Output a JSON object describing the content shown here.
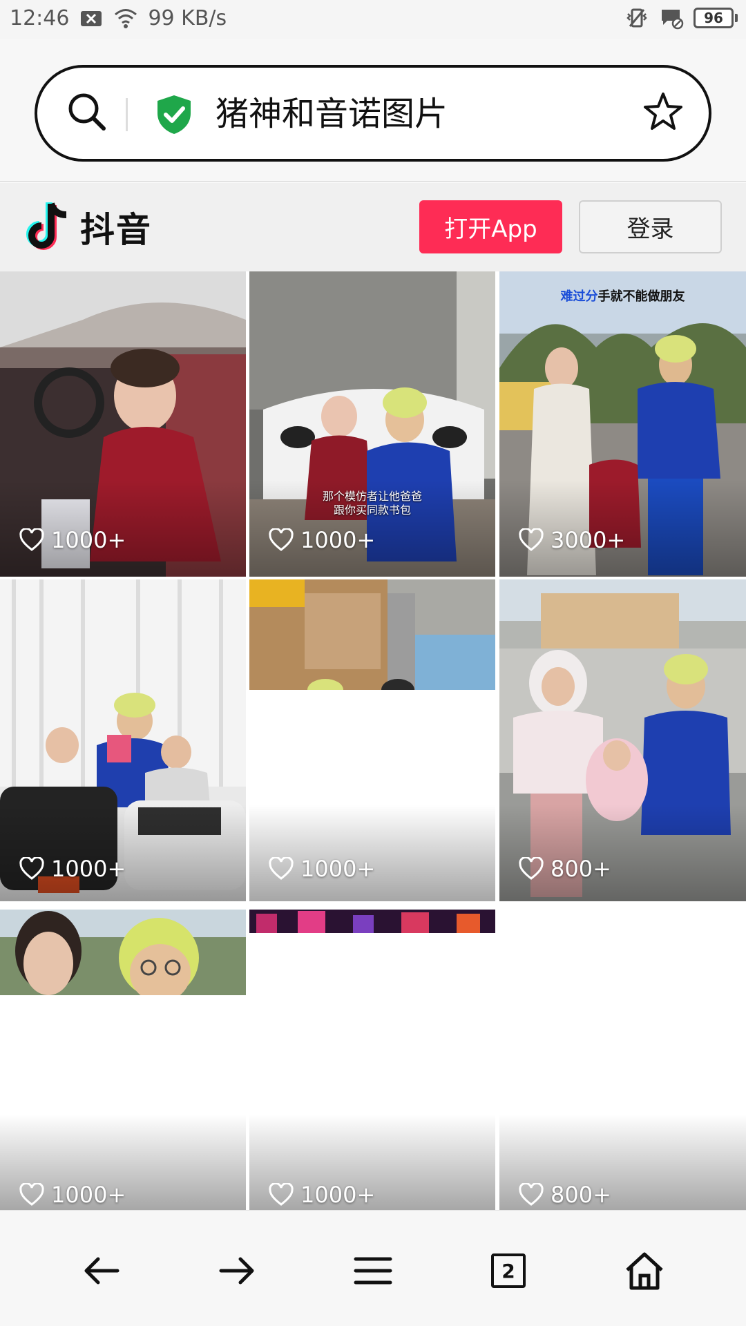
{
  "status_bar": {
    "time": "12:46",
    "network_speed": "99 KB/s",
    "battery": "96",
    "icons": [
      "notification-x-icon",
      "wifi-icon",
      "vibrate-icon",
      "message-off-icon",
      "battery-icon"
    ]
  },
  "browser": {
    "address_text": "猪神和音诺图片",
    "icons": [
      "search-icon",
      "shield-check-icon",
      "star-icon"
    ],
    "accent_color": "#1fa74a"
  },
  "douyin_header": {
    "logo_text": "抖音",
    "open_app_label": "打开App",
    "login_label": "登录",
    "brand_color": "#fe2c55"
  },
  "videos": [
    {
      "likes": "1000+",
      "caption": "",
      "top_caption": ""
    },
    {
      "likes": "1000+",
      "caption": "那个模仿者让他爸爸\n跟你买同款书包",
      "top_caption": ""
    },
    {
      "likes": "3000+",
      "caption": "",
      "top_caption_highlight": "难过分",
      "top_caption": "手就不能做朋友"
    },
    {
      "likes": "1000+",
      "caption": "",
      "top_caption": ""
    },
    {
      "likes": "1000+",
      "caption": "",
      "top_caption": ""
    },
    {
      "likes": "800+",
      "caption": "",
      "top_caption": ""
    },
    {
      "likes": "1000+",
      "caption": "",
      "top_caption": ""
    },
    {
      "likes": "1000+",
      "caption": "",
      "top_caption": ""
    },
    {
      "likes": "800+",
      "caption": "",
      "top_caption": ""
    }
  ],
  "bottom_nav": {
    "tab_count": "2",
    "icons": [
      "back-arrow-icon",
      "forward-arrow-icon",
      "menu-icon",
      "tabs-icon",
      "home-icon"
    ]
  }
}
